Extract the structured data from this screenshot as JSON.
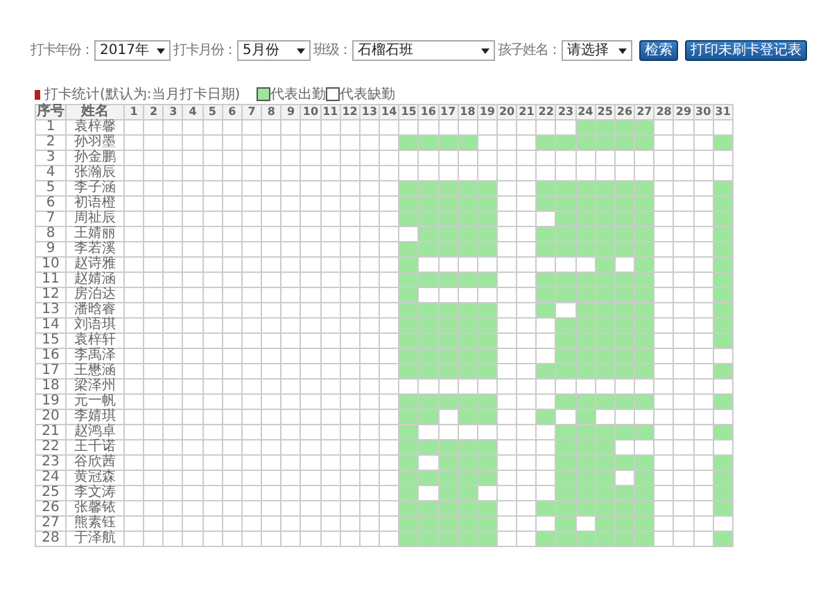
{
  "filters": [
    {
      "label": "打卡年份：",
      "value": "2017年"
    },
    {
      "label": "打卡月份：",
      "value": "5月份"
    },
    {
      "label": "班级：",
      "value": "石榴石班"
    },
    {
      "label": "孩子姓名：",
      "value": "请选择"
    }
  ],
  "buttons": [
    "检索",
    "打印未刷卡登记表"
  ],
  "section_title": "打卡统计(默认为:当月打卡日期)",
  "legend": [
    {
      "label": "代表出勤",
      "present": true
    },
    {
      "label": "代表缺勤",
      "present": false
    }
  ],
  "table": {
    "columns": [
      "序号",
      "姓名",
      "1",
      "2",
      "3",
      "4",
      "5",
      "6",
      "7",
      "8",
      "9",
      "10",
      "11",
      "12",
      "13",
      "14",
      "15",
      "16",
      "17",
      "18",
      "19",
      "20",
      "21",
      "22",
      "23",
      "24",
      "25",
      "26",
      "27",
      "28",
      "29",
      "30",
      "31"
    ],
    "rows": [
      {
        "no": "1",
        "name": "袁梓馨",
        "present": [
          false,
          false,
          false,
          false,
          false,
          false,
          false,
          false,
          false,
          false,
          false,
          false,
          false,
          false,
          false,
          false,
          false,
          false,
          false,
          false,
          false,
          false,
          false,
          true,
          true,
          true,
          true,
          false,
          false,
          false,
          false
        ]
      },
      {
        "no": "2",
        "name": "孙羽墨",
        "present": [
          false,
          false,
          false,
          false,
          false,
          false,
          false,
          false,
          false,
          false,
          false,
          false,
          false,
          false,
          true,
          true,
          true,
          true,
          false,
          false,
          false,
          true,
          true,
          true,
          true,
          true,
          true,
          false,
          false,
          false,
          true
        ]
      },
      {
        "no": "3",
        "name": "孙金鹏",
        "present": [
          false,
          false,
          false,
          false,
          false,
          false,
          false,
          false,
          false,
          false,
          false,
          false,
          false,
          false,
          false,
          false,
          false,
          false,
          false,
          false,
          false,
          false,
          false,
          false,
          false,
          false,
          false,
          false,
          false,
          false,
          false
        ]
      },
      {
        "no": "4",
        "name": "张瀚辰",
        "present": [
          false,
          false,
          false,
          false,
          false,
          false,
          false,
          false,
          false,
          false,
          false,
          false,
          false,
          false,
          false,
          false,
          false,
          false,
          false,
          false,
          false,
          false,
          false,
          false,
          false,
          false,
          false,
          false,
          false,
          false,
          false
        ]
      },
      {
        "no": "5",
        "name": "李子涵",
        "present": [
          false,
          false,
          false,
          false,
          false,
          false,
          false,
          false,
          false,
          false,
          false,
          false,
          false,
          false,
          true,
          true,
          true,
          true,
          true,
          false,
          false,
          true,
          true,
          true,
          true,
          true,
          true,
          false,
          false,
          false,
          true
        ]
      },
      {
        "no": "6",
        "name": "初语橙",
        "present": [
          false,
          false,
          false,
          false,
          false,
          false,
          false,
          false,
          false,
          false,
          false,
          false,
          false,
          false,
          true,
          true,
          true,
          true,
          true,
          false,
          false,
          true,
          true,
          true,
          true,
          true,
          true,
          false,
          false,
          false,
          true
        ]
      },
      {
        "no": "7",
        "name": "周祉辰",
        "present": [
          false,
          false,
          false,
          false,
          false,
          false,
          false,
          false,
          false,
          false,
          false,
          false,
          false,
          false,
          true,
          true,
          true,
          true,
          true,
          false,
          false,
          false,
          true,
          true,
          true,
          true,
          true,
          false,
          false,
          false,
          true
        ]
      },
      {
        "no": "8",
        "name": "王婧丽",
        "present": [
          false,
          false,
          false,
          false,
          false,
          false,
          false,
          false,
          false,
          false,
          false,
          false,
          false,
          false,
          false,
          true,
          true,
          true,
          true,
          false,
          false,
          true,
          true,
          true,
          true,
          true,
          true,
          false,
          false,
          false,
          true
        ]
      },
      {
        "no": "9",
        "name": "李若溪",
        "present": [
          false,
          false,
          false,
          false,
          false,
          false,
          false,
          false,
          false,
          false,
          false,
          false,
          false,
          false,
          true,
          true,
          true,
          true,
          true,
          false,
          false,
          true,
          true,
          true,
          true,
          true,
          true,
          false,
          false,
          false,
          true
        ]
      },
      {
        "no": "10",
        "name": "赵诗雅",
        "present": [
          false,
          false,
          false,
          false,
          false,
          false,
          false,
          false,
          false,
          false,
          false,
          false,
          false,
          false,
          true,
          false,
          false,
          false,
          false,
          false,
          false,
          false,
          false,
          false,
          true,
          false,
          true,
          false,
          false,
          false,
          true
        ]
      },
      {
        "no": "11",
        "name": "赵婧涵",
        "present": [
          false,
          false,
          false,
          false,
          false,
          false,
          false,
          false,
          false,
          false,
          false,
          false,
          false,
          false,
          true,
          true,
          true,
          true,
          true,
          false,
          false,
          true,
          true,
          true,
          true,
          true,
          true,
          false,
          false,
          false,
          true
        ]
      },
      {
        "no": "12",
        "name": "房泊达",
        "present": [
          false,
          false,
          false,
          false,
          false,
          false,
          false,
          false,
          false,
          false,
          false,
          false,
          false,
          false,
          true,
          false,
          false,
          false,
          false,
          false,
          false,
          true,
          true,
          true,
          true,
          true,
          true,
          false,
          false,
          false,
          true
        ]
      },
      {
        "no": "13",
        "name": "潘晗睿",
        "present": [
          false,
          false,
          false,
          false,
          false,
          false,
          false,
          false,
          false,
          false,
          false,
          false,
          false,
          false,
          true,
          true,
          true,
          true,
          true,
          false,
          false,
          true,
          false,
          true,
          true,
          true,
          true,
          false,
          false,
          false,
          true
        ]
      },
      {
        "no": "14",
        "name": "刘语琪",
        "present": [
          false,
          false,
          false,
          false,
          false,
          false,
          false,
          false,
          false,
          false,
          false,
          false,
          false,
          false,
          true,
          true,
          true,
          true,
          true,
          false,
          false,
          false,
          true,
          true,
          true,
          true,
          true,
          false,
          false,
          false,
          true
        ]
      },
      {
        "no": "15",
        "name": "袁梓轩",
        "present": [
          false,
          false,
          false,
          false,
          false,
          false,
          false,
          false,
          false,
          false,
          false,
          false,
          false,
          false,
          true,
          true,
          true,
          true,
          true,
          false,
          false,
          false,
          true,
          true,
          true,
          true,
          true,
          false,
          false,
          false,
          true
        ]
      },
      {
        "no": "16",
        "name": "李禹泽",
        "present": [
          false,
          false,
          false,
          false,
          false,
          false,
          false,
          false,
          false,
          false,
          false,
          false,
          false,
          false,
          true,
          true,
          true,
          true,
          true,
          false,
          false,
          false,
          true,
          true,
          true,
          true,
          true,
          false,
          false,
          false,
          false
        ]
      },
      {
        "no": "17",
        "name": "王懋涵",
        "present": [
          false,
          false,
          false,
          false,
          false,
          false,
          false,
          false,
          false,
          false,
          false,
          false,
          false,
          false,
          true,
          true,
          true,
          true,
          true,
          false,
          false,
          true,
          true,
          true,
          true,
          true,
          true,
          false,
          false,
          false,
          true
        ]
      },
      {
        "no": "18",
        "name": "梁泽州",
        "present": [
          false,
          false,
          false,
          false,
          false,
          false,
          false,
          false,
          false,
          false,
          false,
          false,
          false,
          false,
          false,
          false,
          false,
          false,
          false,
          false,
          false,
          false,
          false,
          false,
          false,
          false,
          false,
          false,
          false,
          false,
          false
        ]
      },
      {
        "no": "19",
        "name": "元一帆",
        "present": [
          false,
          false,
          false,
          false,
          false,
          false,
          false,
          false,
          false,
          false,
          false,
          false,
          false,
          false,
          true,
          true,
          true,
          true,
          true,
          false,
          false,
          false,
          true,
          true,
          true,
          true,
          true,
          false,
          false,
          false,
          true
        ]
      },
      {
        "no": "20",
        "name": "李婧琪",
        "present": [
          false,
          false,
          false,
          false,
          false,
          false,
          false,
          false,
          false,
          false,
          false,
          false,
          false,
          false,
          true,
          true,
          false,
          true,
          true,
          false,
          false,
          true,
          false,
          true,
          false,
          false,
          false,
          false,
          false,
          false,
          false
        ]
      },
      {
        "no": "21",
        "name": "赵鸿卓",
        "present": [
          false,
          false,
          false,
          false,
          false,
          false,
          false,
          false,
          false,
          false,
          false,
          false,
          false,
          false,
          true,
          false,
          false,
          false,
          false,
          false,
          false,
          false,
          true,
          true,
          true,
          true,
          true,
          false,
          false,
          false,
          true
        ]
      },
      {
        "no": "22",
        "name": "王千诺",
        "present": [
          false,
          false,
          false,
          false,
          false,
          false,
          false,
          false,
          false,
          false,
          false,
          false,
          false,
          false,
          true,
          true,
          true,
          true,
          true,
          false,
          false,
          false,
          true,
          true,
          true,
          false,
          false,
          false,
          false,
          false,
          false
        ]
      },
      {
        "no": "23",
        "name": "谷欣茜",
        "present": [
          false,
          false,
          false,
          false,
          false,
          false,
          false,
          false,
          false,
          false,
          false,
          false,
          false,
          false,
          true,
          false,
          true,
          true,
          true,
          false,
          false,
          false,
          true,
          true,
          true,
          true,
          true,
          false,
          false,
          false,
          true
        ]
      },
      {
        "no": "24",
        "name": "黄冠森",
        "present": [
          false,
          false,
          false,
          false,
          false,
          false,
          false,
          false,
          false,
          false,
          false,
          false,
          false,
          false,
          true,
          true,
          true,
          true,
          true,
          false,
          false,
          false,
          true,
          true,
          true,
          false,
          true,
          false,
          false,
          false,
          true
        ]
      },
      {
        "no": "25",
        "name": "李文涛",
        "present": [
          false,
          false,
          false,
          false,
          false,
          false,
          false,
          false,
          false,
          false,
          false,
          false,
          false,
          false,
          true,
          false,
          true,
          true,
          false,
          false,
          false,
          false,
          true,
          true,
          true,
          true,
          true,
          false,
          false,
          false,
          true
        ]
      },
      {
        "no": "26",
        "name": "张馨铱",
        "present": [
          false,
          false,
          false,
          false,
          false,
          false,
          false,
          false,
          false,
          false,
          false,
          false,
          false,
          false,
          true,
          true,
          true,
          true,
          true,
          false,
          false,
          true,
          true,
          true,
          true,
          true,
          true,
          false,
          false,
          false,
          true
        ]
      },
      {
        "no": "27",
        "name": "熊素钰",
        "present": [
          false,
          false,
          false,
          false,
          false,
          false,
          false,
          false,
          false,
          false,
          false,
          false,
          false,
          false,
          true,
          true,
          true,
          true,
          true,
          false,
          false,
          false,
          true,
          false,
          true,
          true,
          true,
          false,
          false,
          false,
          false
        ]
      },
      {
        "no": "28",
        "name": "于泽航",
        "present": [
          false,
          false,
          false,
          false,
          false,
          false,
          false,
          false,
          false,
          false,
          false,
          false,
          false,
          false,
          true,
          true,
          true,
          true,
          true,
          false,
          false,
          true,
          true,
          true,
          true,
          true,
          true,
          false,
          false,
          false,
          true
        ]
      }
    ]
  }
}
